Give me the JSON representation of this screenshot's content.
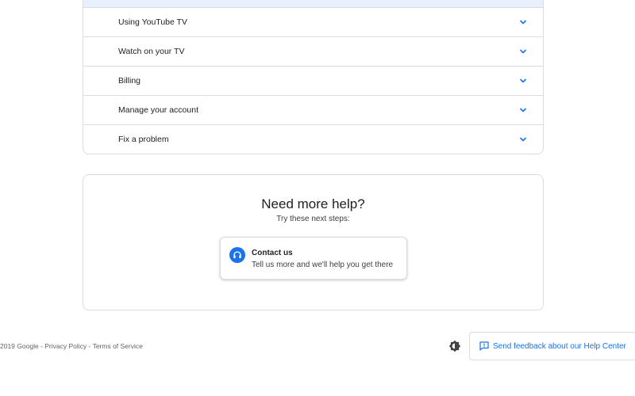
{
  "topics": {
    "items": [
      {
        "label": "Using YouTube TV"
      },
      {
        "label": "Watch on your TV"
      },
      {
        "label": "Billing"
      },
      {
        "label": "Manage your account"
      },
      {
        "label": "Fix a problem"
      }
    ],
    "chevron_icon": "chevron-down-icon"
  },
  "help": {
    "title": "Need more help?",
    "subtitle": "Try these next steps:",
    "contact": {
      "icon": "headset-icon",
      "title": "Contact us",
      "description": "Tell us more and we'll help you get there"
    }
  },
  "footer": {
    "copyright": "2019 Google",
    "separator": " - ",
    "privacy": "Privacy Policy",
    "terms": "Terms of Service",
    "theme_icon": "dark-mode-toggle-icon",
    "feedback": {
      "icon": "feedback-icon",
      "label": "Send feedback about our Help Center"
    }
  },
  "colors": {
    "accent": "#1a73e8",
    "border": "#dadce0",
    "highlight": "#e8f0fe",
    "text": "#202124",
    "muted": "#5f6368"
  }
}
